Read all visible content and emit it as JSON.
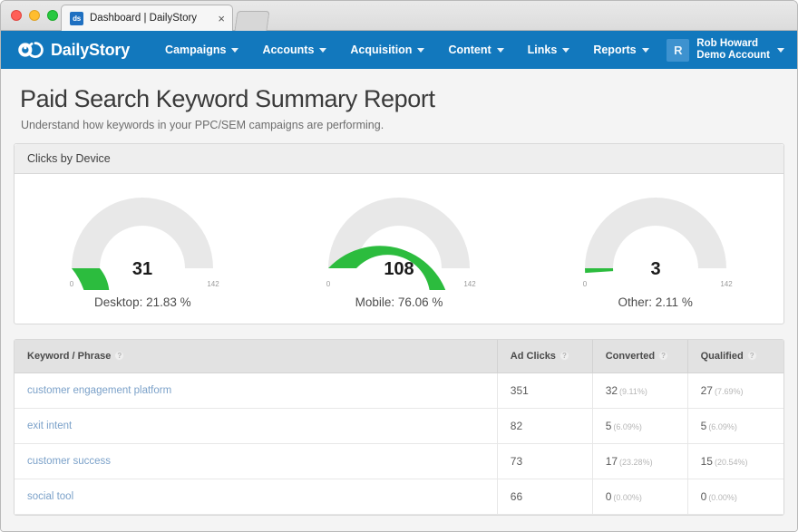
{
  "browser": {
    "tab_favicon_text": "ds",
    "tab_title": "Dashboard | DailyStory",
    "tab_close_glyph": "×"
  },
  "navbar": {
    "brand": "DailyStory",
    "items": [
      {
        "label": "Campaigns"
      },
      {
        "label": "Accounts"
      },
      {
        "label": "Acquisition"
      },
      {
        "label": "Content"
      },
      {
        "label": "Links"
      },
      {
        "label": "Reports"
      }
    ],
    "user": {
      "avatar_initial": "R",
      "name": "Rob Howard",
      "account": "Demo Account"
    },
    "accent_color": "#1278bd"
  },
  "page": {
    "title": "Paid Search Keyword Summary Report",
    "subtitle": "Understand how keywords in your PPC/SEM campaigns are performing."
  },
  "clicks_panel": {
    "title": "Clicks by Device"
  },
  "chart_data": [
    {
      "type": "gauge",
      "title": "Desktop",
      "value": 31,
      "value_label": "31",
      "min": 0,
      "max": 142,
      "min_label": "0",
      "max_label": "142",
      "caption": "Desktop: 21.83 %",
      "percent": 21.83,
      "fill_color": "#2cbc3e",
      "track_color": "#e8e8e8"
    },
    {
      "type": "gauge",
      "title": "Mobile",
      "value": 108,
      "value_label": "108",
      "min": 0,
      "max": 142,
      "min_label": "0",
      "max_label": "142",
      "caption": "Mobile: 76.06 %",
      "percent": 76.06,
      "fill_color": "#2cbc3e",
      "track_color": "#e8e8e8"
    },
    {
      "type": "gauge",
      "title": "Other",
      "value": 3,
      "value_label": "3",
      "min": 0,
      "max": 142,
      "min_label": "0",
      "max_label": "142",
      "caption": "Other: 2.11 %",
      "percent": 2.11,
      "fill_color": "#2cbc3e",
      "track_color": "#e8e8e8"
    }
  ],
  "table": {
    "help_glyph": "?",
    "columns": [
      {
        "label": "Keyword / Phrase"
      },
      {
        "label": "Ad Clicks"
      },
      {
        "label": "Converted"
      },
      {
        "label": "Qualified"
      }
    ],
    "rows": [
      {
        "keyword": "customer engagement platform",
        "ad_clicks": "351",
        "converted": "32",
        "converted_pct": "(9.11%)",
        "qualified": "27",
        "qualified_pct": "(7.69%)"
      },
      {
        "keyword": "exit intent",
        "ad_clicks": "82",
        "converted": "5",
        "converted_pct": "(6.09%)",
        "qualified": "5",
        "qualified_pct": "(6.09%)"
      },
      {
        "keyword": "customer success",
        "ad_clicks": "73",
        "converted": "17",
        "converted_pct": "(23.28%)",
        "qualified": "15",
        "qualified_pct": "(20.54%)"
      },
      {
        "keyword": "social tool",
        "ad_clicks": "66",
        "converted": "0",
        "converted_pct": "(0.00%)",
        "qualified": "0",
        "qualified_pct": "(0.00%)"
      }
    ]
  }
}
